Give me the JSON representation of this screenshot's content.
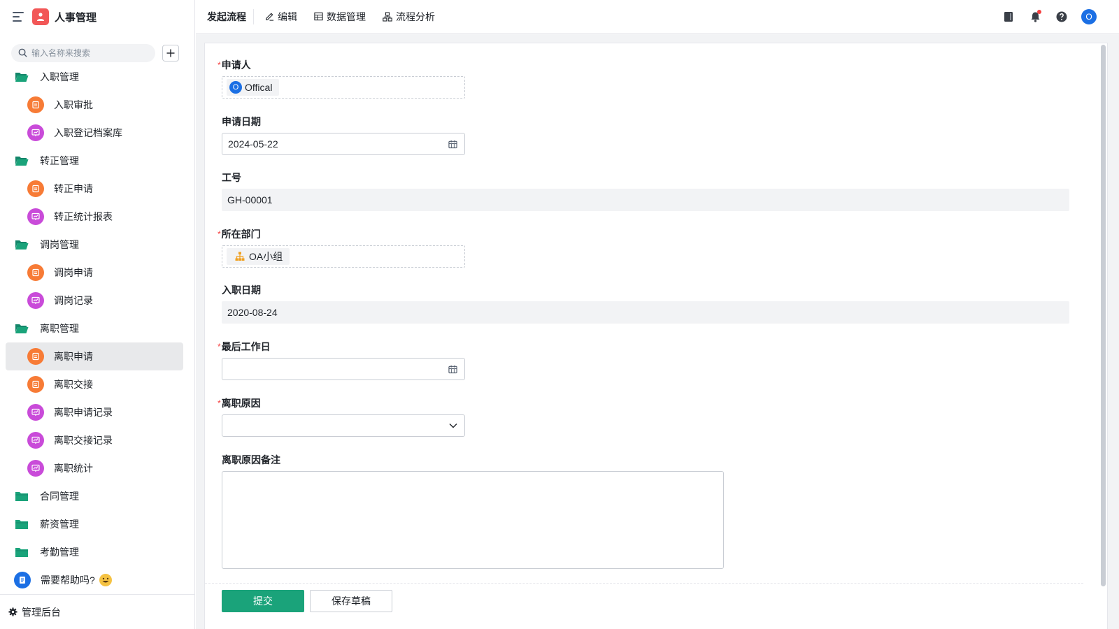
{
  "app": {
    "title": "人事管理",
    "logo_color": "#f25757"
  },
  "search": {
    "placeholder": "输入名称来搜索"
  },
  "sidebar": {
    "groups": [
      {
        "label": "入职管理",
        "items": [
          {
            "label": "入职审批",
            "icon": "form-icon"
          },
          {
            "label": "入职登记档案库",
            "icon": "report-icon"
          }
        ]
      },
      {
        "label": "转正管理",
        "items": [
          {
            "label": "转正申请",
            "icon": "form-icon"
          },
          {
            "label": "转正统计报表",
            "icon": "report-icon"
          }
        ]
      },
      {
        "label": "调岗管理",
        "items": [
          {
            "label": "调岗申请",
            "icon": "form-icon"
          },
          {
            "label": "调岗记录",
            "icon": "report-icon"
          }
        ]
      },
      {
        "label": "离职管理",
        "items": [
          {
            "label": "离职申请",
            "icon": "form-icon",
            "active": true
          },
          {
            "label": "离职交接",
            "icon": "form-icon"
          },
          {
            "label": "离职申请记录",
            "icon": "report-icon"
          },
          {
            "label": "离职交接记录",
            "icon": "report-icon"
          },
          {
            "label": "离职统计",
            "icon": "report-icon"
          }
        ]
      },
      {
        "label": "合同管理",
        "items": []
      },
      {
        "label": "薪资管理",
        "items": []
      },
      {
        "label": "考勤管理",
        "items": []
      }
    ],
    "help": "需要帮助吗?",
    "admin": "管理后台"
  },
  "header": {
    "tabs": [
      {
        "label": "发起流程",
        "icon": ""
      },
      {
        "label": "编辑",
        "icon": "edit-icon"
      },
      {
        "label": "数据管理",
        "icon": "table-icon"
      },
      {
        "label": "流程分析",
        "icon": "flow-icon"
      }
    ],
    "avatar": "O"
  },
  "form": {
    "applicant": {
      "label": "申请人",
      "required": true,
      "value": "Offical",
      "avatar": "O"
    },
    "apply_date": {
      "label": "申请日期",
      "value": "2024-05-22"
    },
    "employee_no": {
      "label": "工号",
      "value": "GH-00001"
    },
    "department": {
      "label": "所在部门",
      "required": true,
      "value": "OA小组"
    },
    "hire_date": {
      "label": "入职日期",
      "value": "2020-08-24"
    },
    "last_day": {
      "label": "最后工作日",
      "required": true,
      "value": ""
    },
    "reason": {
      "label": "离职原因",
      "required": true,
      "value": ""
    },
    "reason_note": {
      "label": "离职原因备注",
      "value": ""
    }
  },
  "actions": {
    "submit": "提交",
    "draft": "保存草稿"
  },
  "colors": {
    "accent": "#1aa37a",
    "folder": "#1aa37a",
    "form_icon": "#f77b36",
    "report_icon": "#c94bd9",
    "required": "#f53f3f"
  }
}
